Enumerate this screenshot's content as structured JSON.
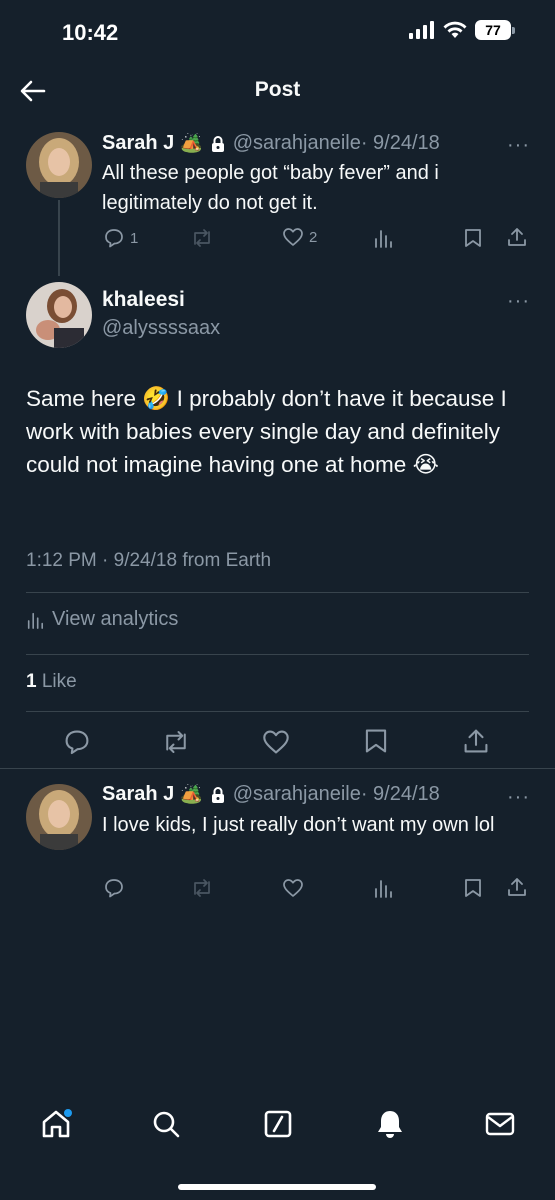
{
  "status_bar": {
    "time": "10:42",
    "battery": "77"
  },
  "header": {
    "title": "Post"
  },
  "parent_tweet": {
    "name": "Sarah J",
    "name_emoji": "🏕️",
    "handle": "@sarahjaneile",
    "date": "· 9/24/18",
    "text": "All these people got “baby fever” and i legitimately do not get it.",
    "reply_count": "1",
    "like_count": "2"
  },
  "main_tweet": {
    "name": "khaleesi",
    "handle": "@alyssssaax",
    "text": "Same here 🤣 I probably don’t have it because I work with babies every single day and definitely could not imagine having one at home 😭",
    "meta": "1:12 PM · 9/24/18 from Earth",
    "analytics_label": "View analytics",
    "like_count": "1",
    "like_label": "Like"
  },
  "reply_tweet": {
    "name": "Sarah J",
    "name_emoji": "🏕️",
    "handle": "@sarahjaneile",
    "date": "· 9/24/18",
    "text": "I love kids, I just really don’t want my own lol"
  },
  "tab_bar": [
    "home-icon",
    "search-icon",
    "grok-icon",
    "notifications-icon",
    "messages-icon"
  ],
  "colors": {
    "background": "#15202b",
    "text": "#f7f9f9",
    "secondary": "#8b98a5",
    "divider": "#38444d",
    "accent": "#1d9bf0"
  }
}
